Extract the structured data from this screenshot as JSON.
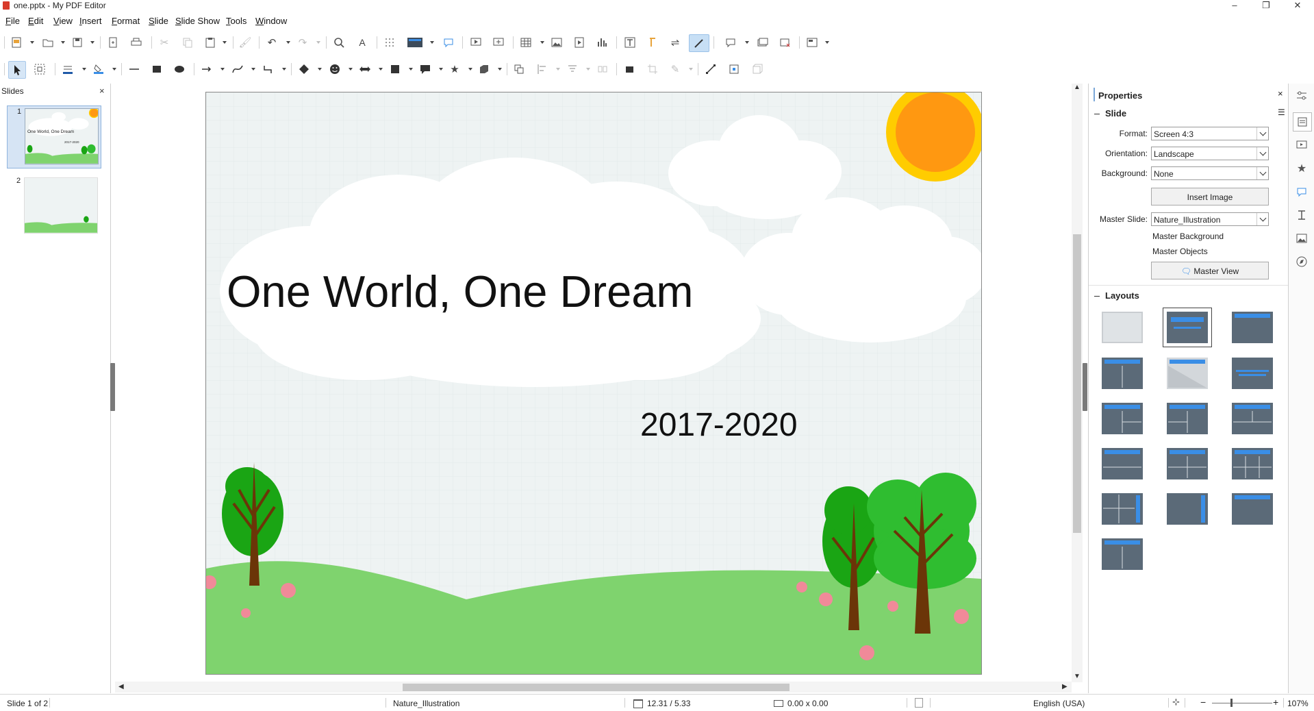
{
  "window": {
    "title": "one.pptx - My PDF Editor",
    "minimize": "–",
    "restore": "❐",
    "close": "✕"
  },
  "menu": [
    "File",
    "Edit",
    "View",
    "Insert",
    "Format",
    "Slide",
    "Slide Show",
    "Tools",
    "Window"
  ],
  "slides_pane": {
    "title": "Slides",
    "close": "×",
    "items": [
      {
        "num": "1"
      },
      {
        "num": "2"
      }
    ]
  },
  "slide": {
    "title": "One World, One Dream",
    "subtitle": "2017-2020"
  },
  "thumb1": {
    "title": "One World, One Dream",
    "subtitle": "2017-2020"
  },
  "properties": {
    "title": "Properties",
    "close": "×",
    "slide_section": "Slide",
    "format_label": "Format:",
    "format_value": "Screen 4:3",
    "orientation_label": "Orientation:",
    "orientation_value": "Landscape",
    "background_label": "Background:",
    "background_value": "None",
    "insert_image": "Insert Image",
    "master_slide_label": "Master Slide:",
    "master_slide_value": "Nature_Illustration",
    "master_background": "Master Background",
    "master_objects": "Master Objects",
    "master_view": "Master View",
    "layouts_section": "Layouts"
  },
  "statusbar": {
    "slide_of": "Slide 1 of 2",
    "master": "Nature_Illustration",
    "position": "12.31 / 5.33",
    "size": "0.00 x 0.00",
    "language": "English (USA)",
    "zoom": "107%"
  },
  "colors": {
    "accent": "#3a8ee6",
    "sun": "#ff9811",
    "sun_ring": "#ffcc00",
    "grass": "#7fd36e",
    "tree": "#1aa514",
    "trunk": "#6b3508",
    "flower": "#f08a99"
  }
}
